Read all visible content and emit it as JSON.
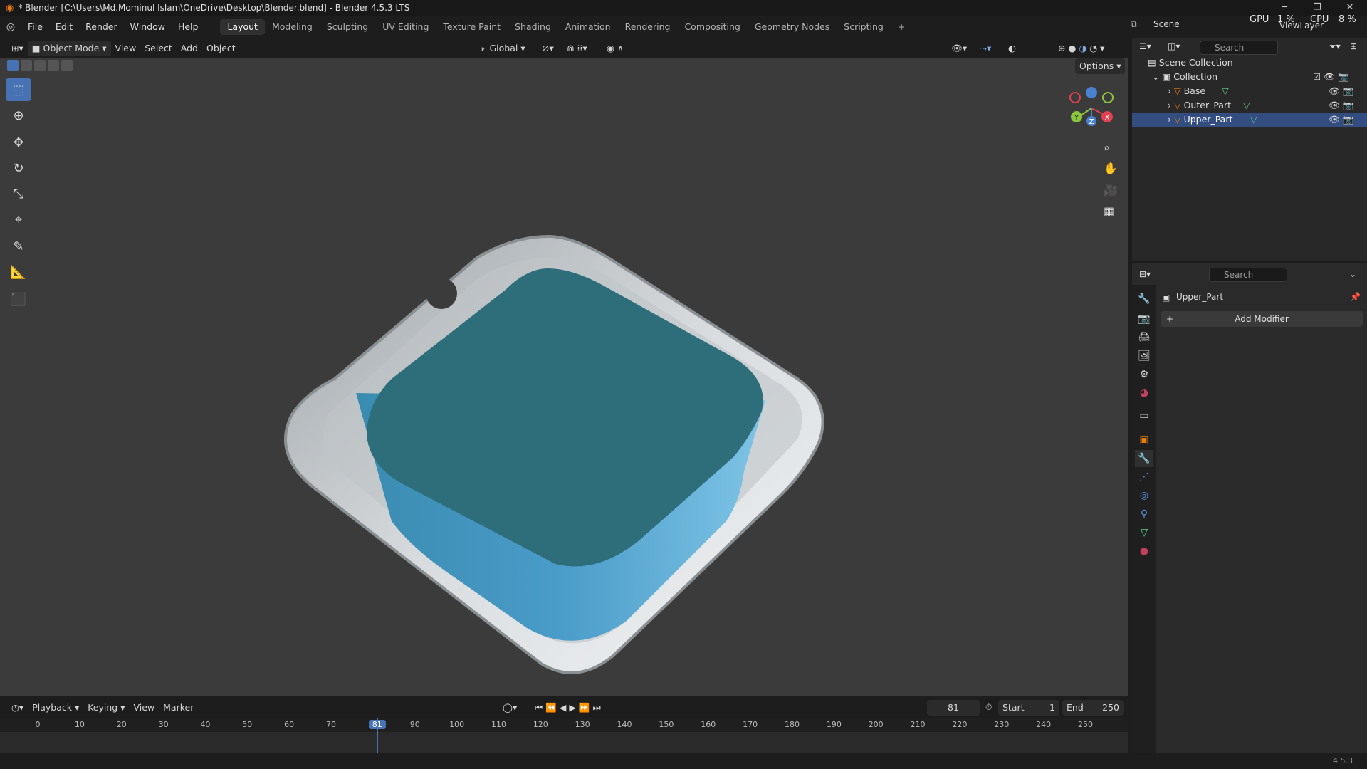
{
  "window": {
    "title": "* Blender [C:\\Users\\Md.Mominul Islam\\OneDrive\\Desktop\\Blender.blend] - Blender 4.5.3 LTS",
    "min_icon": "minimize-icon",
    "max_icon": "maximize-icon",
    "close_icon": "close-icon"
  },
  "menubar": {
    "menus": [
      "File",
      "Edit",
      "Render",
      "Window",
      "Help"
    ],
    "workspaces": [
      "Layout",
      "Modeling",
      "Sculpting",
      "UV Editing",
      "Texture Paint",
      "Shading",
      "Animation",
      "Rendering",
      "Compositing",
      "Geometry Nodes",
      "Scripting"
    ],
    "active_workspace": "Layout",
    "add_tab": "+",
    "scene_label": "Scene",
    "view_layer_label": "ViewLayer",
    "gpu_label": "GPU",
    "gpu_value": "1 %",
    "cpu_label": "CPU",
    "cpu_value": "8 %"
  },
  "viewport_header": {
    "mode": "Object Mode",
    "menus": [
      "View",
      "Select",
      "Add",
      "Object"
    ],
    "orientation": "Global",
    "options": "Options"
  },
  "outliner": {
    "search_placeholder": "Search",
    "root": "Scene Collection",
    "collection": "Collection",
    "objects": [
      "Base",
      "Outer_Part",
      "Upper_Part"
    ],
    "selected": "Upper_Part"
  },
  "properties": {
    "search_placeholder": "Search",
    "object_name": "Upper_Part",
    "add_modifier": "Add Modifier"
  },
  "timeline": {
    "menus": [
      "Playback",
      "Keying",
      "View",
      "Marker"
    ],
    "current_frame": "81",
    "start_label": "Start",
    "start_value": "1",
    "end_label": "End",
    "end_value": "250",
    "ticks": [
      "0",
      "10",
      "20",
      "30",
      "40",
      "50",
      "60",
      "70",
      "81",
      "90",
      "100",
      "110",
      "120",
      "130",
      "140",
      "150",
      "160",
      "170",
      "180",
      "190",
      "200",
      "210",
      "220",
      "230",
      "240",
      "250"
    ]
  },
  "gizmo": {
    "x": "X",
    "y": "Y",
    "z": "Z"
  },
  "version": "4.5.3",
  "colors": {
    "accent": "#4772b3",
    "selected_row": "#334d80",
    "object_fill": "#2d6e7a",
    "object_side": "#3d8ab4",
    "tray": "#cfd3d6"
  }
}
